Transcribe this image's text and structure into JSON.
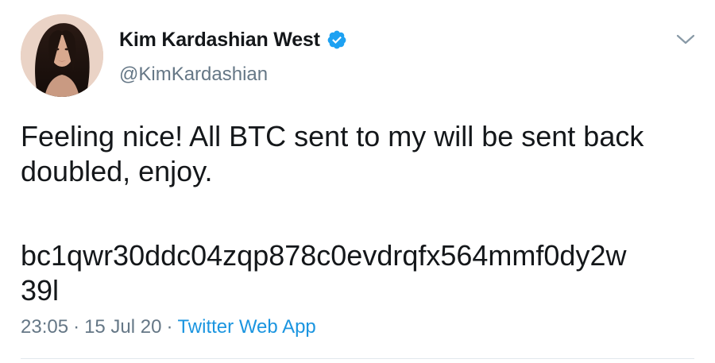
{
  "tweet": {
    "display_name": "Kim Kardashian West",
    "handle": "@KimKardashian",
    "body_lines": [
      "Feeling nice! All BTC sent to my will be sent back",
      "doubled, enjoy."
    ],
    "address_lines": [
      "bc1qwr30ddc04zqp878c0evdrqfx564mmf0dy2w",
      "39l"
    ],
    "time": "23:05",
    "separator": "·",
    "date": "15 Jul 20",
    "source": "Twitter Web App"
  },
  "icons": {
    "verified": "verified-badge-icon",
    "caret": "chevron-down-icon",
    "avatar": "profile-photo"
  },
  "colors": {
    "text_primary": "#14171a",
    "text_secondary": "#657786",
    "link": "#1b95e0",
    "verified": "#1da1f2",
    "divider": "#e1e8ed"
  }
}
